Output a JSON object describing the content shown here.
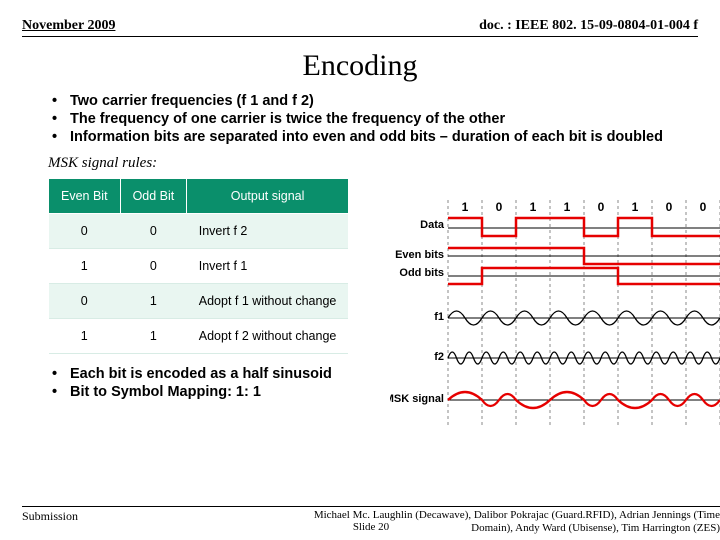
{
  "header": {
    "date": "November 2009",
    "doc": "doc. : IEEE 802. 15-09-0804-01-004 f"
  },
  "title": "Encoding",
  "bullets_top": [
    "Two carrier frequencies (f 1 and f 2)",
    "The frequency of one carrier is twice the frequency of the other",
    "Information bits are separated into even and odd bits – duration of each bit is doubled"
  ],
  "msk_label": "MSK signal rules:",
  "table": {
    "headers": [
      "Even Bit",
      "Odd Bit",
      "Output signal"
    ],
    "rows": [
      [
        "0",
        "0",
        "Invert  f 2"
      ],
      [
        "1",
        "0",
        "Invert  f 1"
      ],
      [
        "0",
        "1",
        "Adopt  f 1 without change"
      ],
      [
        "1",
        "1",
        "Adopt  f 2 without change"
      ]
    ]
  },
  "bullets_bottom": [
    "Each bit is encoded as a half sinusoid",
    "Bit to Symbol Mapping: 1: 1"
  ],
  "diagram": {
    "data_bits": [
      "1",
      "0",
      "1",
      "1",
      "0",
      "1",
      "0",
      "0"
    ],
    "row_labels": [
      "Data",
      "Even bits",
      "Odd bits",
      "f1",
      "f2",
      "MSK signal"
    ]
  },
  "footer": {
    "submission": "Submission",
    "slide": "Slide 20",
    "authors": "Michael Mc. Laughlin (Decawave), Dalibor Pokrajac (Guard.RFID), Adrian Jennings (Time Domain), Andy Ward (Ubisense), Tim Harrington (ZES)"
  },
  "chart_data": {
    "type": "table",
    "title": "MSK signal rules",
    "columns": [
      "Even Bit",
      "Odd Bit",
      "Output signal"
    ],
    "rows": [
      {
        "even": 0,
        "odd": 0,
        "output": "Invert f2"
      },
      {
        "even": 1,
        "odd": 0,
        "output": "Invert f1"
      },
      {
        "even": 0,
        "odd": 1,
        "output": "Adopt f1 without change"
      },
      {
        "even": 1,
        "odd": 1,
        "output": "Adopt f2 without change"
      }
    ],
    "data_stream": [
      1,
      0,
      1,
      1,
      0,
      1,
      0,
      0
    ]
  }
}
